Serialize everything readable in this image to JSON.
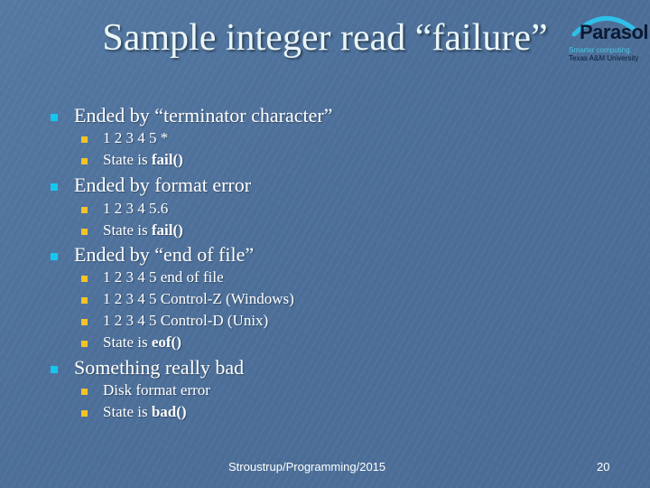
{
  "slide": {
    "title": "Sample integer read “failure”",
    "logo": {
      "name": "Parasol",
      "tagline": "Smarter computing.",
      "institution": "Texas A&M University"
    },
    "bullets": [
      {
        "text": "Ended by “terminator character”",
        "sub": [
          {
            "text": "1 2 3 4 5 *",
            "bold": ""
          },
          {
            "text": "State is ",
            "bold": "fail()"
          }
        ]
      },
      {
        "text": "Ended by format error",
        "sub": [
          {
            "text": "1 2 3 4 5.6",
            "bold": ""
          },
          {
            "text": "State is ",
            "bold": "fail()"
          }
        ]
      },
      {
        "text": "Ended by “end of file”",
        "sub": [
          {
            "text": "1 2 3 4 5 end of file",
            "bold": ""
          },
          {
            "text": "1 2 3 4 5 Control-Z (Windows)",
            "bold": ""
          },
          {
            "text": "1 2 3 4 5 Control-D (Unix)",
            "bold": ""
          },
          {
            "text": "State is ",
            "bold": "eof()"
          }
        ]
      },
      {
        "text": "Something really bad",
        "sub": [
          {
            "text": "Disk format error",
            "bold": ""
          },
          {
            "text": "State is ",
            "bold": "bad()"
          }
        ]
      }
    ],
    "footer": {
      "source": "Stroustrup/Programming/2015",
      "page_number": "20"
    },
    "colors": {
      "background": "#4c6f99",
      "level1_bullet": "#14c7f0",
      "level2_bullet": "#f5c324",
      "title_text": "#eaf6f6"
    }
  }
}
